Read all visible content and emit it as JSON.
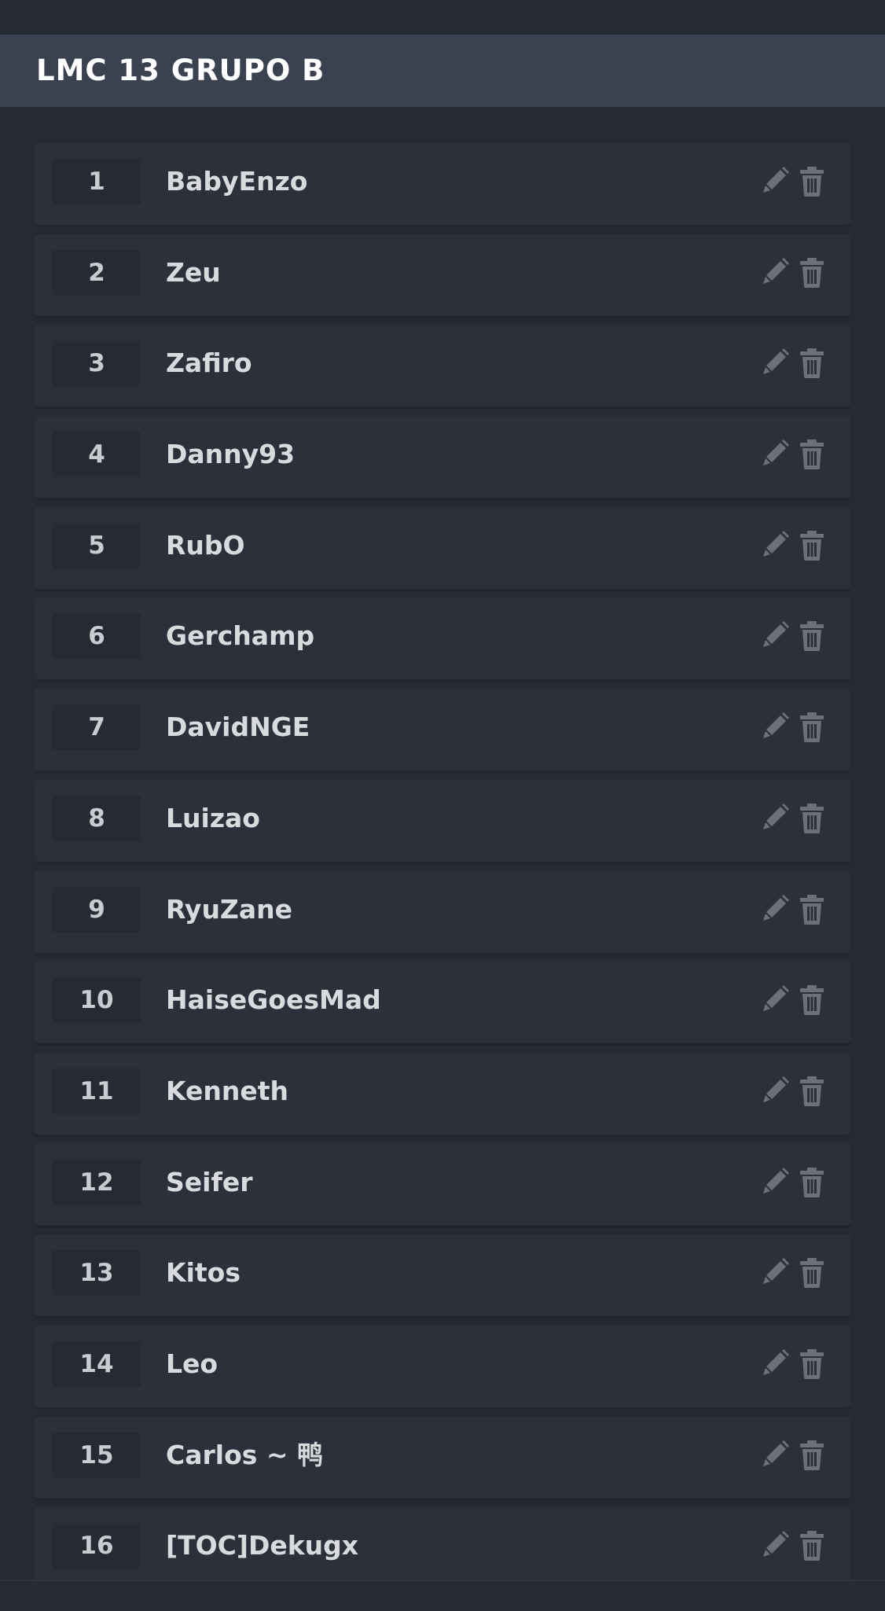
{
  "header": {
    "title": "LMC 13 GRUPO B"
  },
  "participants": [
    {
      "seed": "1",
      "name": "BabyEnzo"
    },
    {
      "seed": "2",
      "name": "Zeu"
    },
    {
      "seed": "3",
      "name": "Zafiro"
    },
    {
      "seed": "4",
      "name": "Danny93"
    },
    {
      "seed": "5",
      "name": "RubO"
    },
    {
      "seed": "6",
      "name": "Gerchamp"
    },
    {
      "seed": "7",
      "name": "DavidNGE"
    },
    {
      "seed": "8",
      "name": "Luizao"
    },
    {
      "seed": "9",
      "name": "RyuZane"
    },
    {
      "seed": "10",
      "name": "HaiseGoesMad"
    },
    {
      "seed": "11",
      "name": "Kenneth"
    },
    {
      "seed": "12",
      "name": "Seifer"
    },
    {
      "seed": "13",
      "name": "Kitos"
    },
    {
      "seed": "14",
      "name": "Leo"
    },
    {
      "seed": "15",
      "name": "Carlos ~ 鸭"
    },
    {
      "seed": "16",
      "name": "[TOC]Dekugx"
    }
  ],
  "icons": {
    "edit": "pencil-icon",
    "delete": "trash-icon"
  },
  "colors": {
    "background": "#262a33",
    "header": "#3a4150",
    "row": "#2c303b",
    "icon": "#6b7079"
  }
}
